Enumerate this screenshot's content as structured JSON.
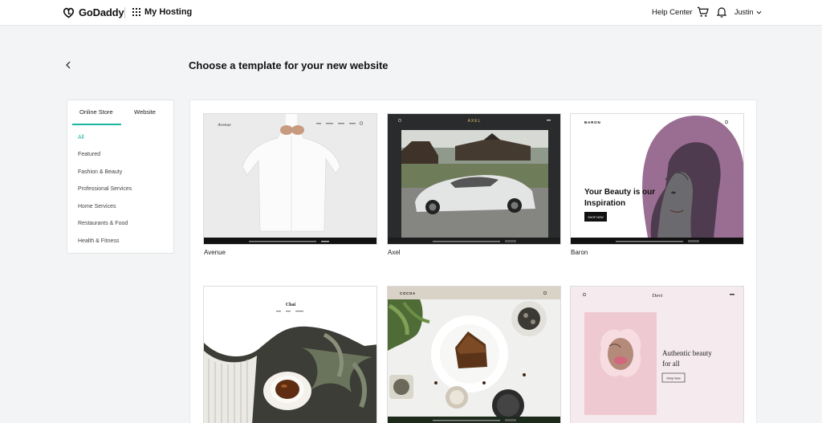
{
  "topbar": {
    "logo_text": "GoDaddy",
    "section_label": "My Hosting",
    "help_label": "Help Center",
    "user_name": "Justin"
  },
  "header": {
    "title": "Choose a template for your new website"
  },
  "sidebar": {
    "tabs": [
      {
        "label": "Online Store"
      },
      {
        "label": "Website"
      }
    ],
    "categories": [
      {
        "label": "All"
      },
      {
        "label": "Featured"
      },
      {
        "label": "Fashion & Beauty"
      },
      {
        "label": "Professional Services"
      },
      {
        "label": "Home Services"
      },
      {
        "label": "Restaurants & Food"
      },
      {
        "label": "Health & Fitness"
      }
    ]
  },
  "templates": [
    {
      "name": "Avenue",
      "brand": "Avenue"
    },
    {
      "name": "Axel",
      "brand": "AXEL"
    },
    {
      "name": "Baron",
      "brand": "BARON",
      "headline": "Your Beauty is our Inspiration",
      "cta": "SHOP NOW"
    },
    {
      "name": "",
      "brand": "Chai"
    },
    {
      "name": "",
      "brand": "COCOA"
    },
    {
      "name": "",
      "brand": "Devi",
      "headline": "Authentic beauty for all",
      "cta": "Shop Now"
    }
  ],
  "colors": {
    "accent": "#1bb6a1",
    "background": "#f3f4f5"
  }
}
